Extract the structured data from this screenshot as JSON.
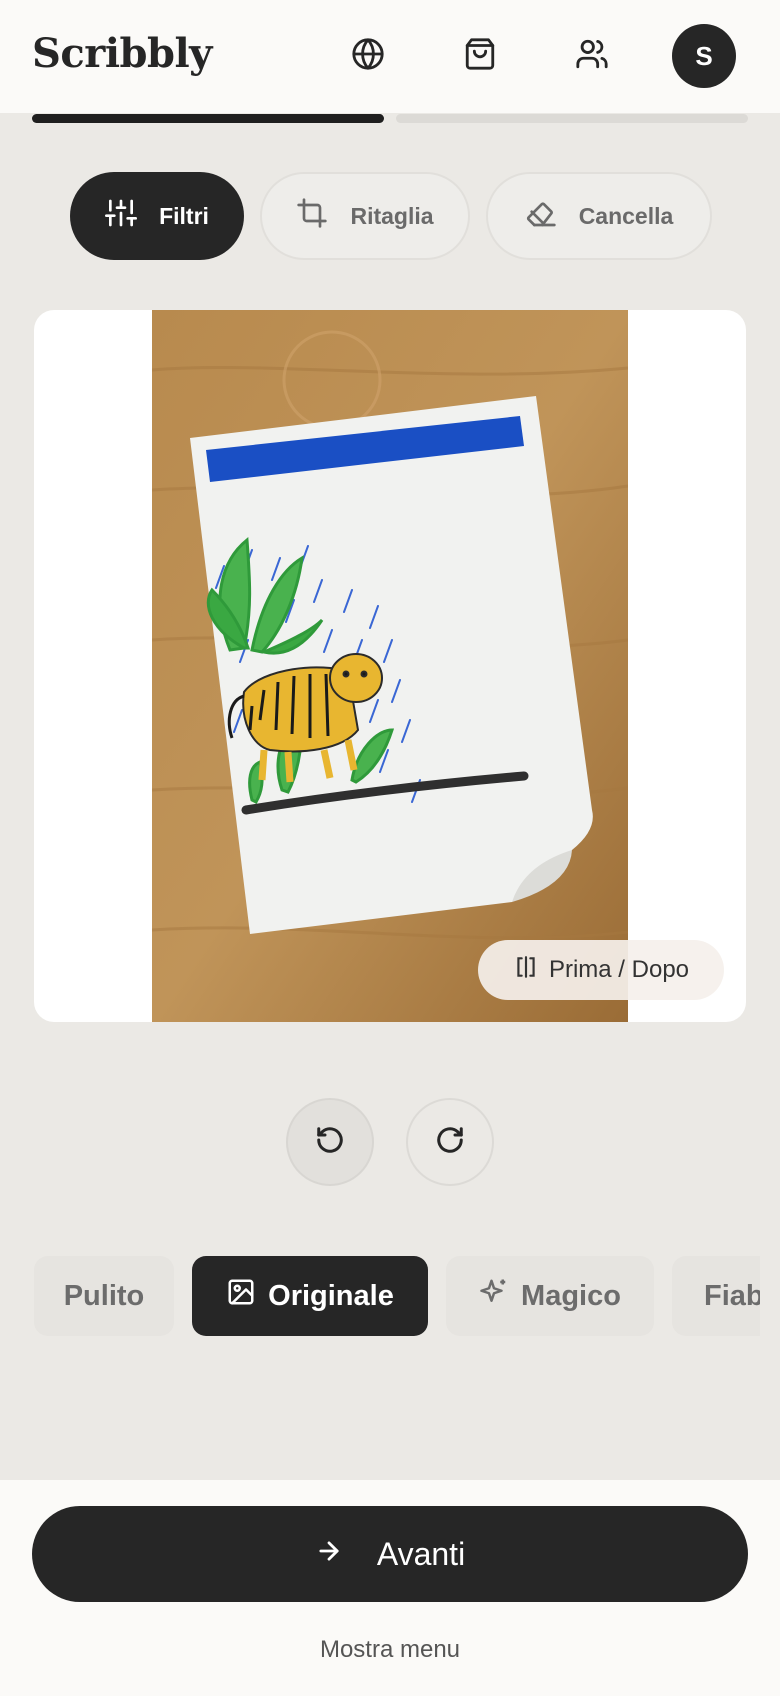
{
  "app": {
    "title": "Scribbly"
  },
  "header": {
    "icons": [
      "globe-icon",
      "shopping-bag-icon",
      "users-icon"
    ],
    "avatar_initial": "S"
  },
  "progress": {
    "step": 1,
    "total_steps": 2,
    "fraction": 0.5
  },
  "toolbar": {
    "tools": [
      {
        "label": "Filtri",
        "icon": "sliders-icon",
        "active": true
      },
      {
        "label": "Ritaglia",
        "icon": "crop-icon",
        "active": false
      },
      {
        "label": "Cancella",
        "icon": "eraser-icon",
        "active": false
      }
    ]
  },
  "preview": {
    "compare_label": "Prima / Dopo",
    "compare_icon": "compare-icon"
  },
  "history": {
    "undo_icon": "undo-icon",
    "redo_icon": "redo-icon"
  },
  "filters": [
    {
      "label": "Pulito",
      "icon": "",
      "active": false
    },
    {
      "label": "Originale",
      "icon": "image-icon",
      "active": true
    },
    {
      "label": "Magico",
      "icon": "sparkles-icon",
      "active": false
    },
    {
      "label": "Fiab",
      "icon": "",
      "active": false
    }
  ],
  "footer": {
    "next_label": "Avanti",
    "next_icon": "arrow-right-icon",
    "menu_label": "Mostra menu"
  },
  "colors": {
    "primary": "#262626",
    "background": "#ebe9e5",
    "surface": "#fbfaf8"
  }
}
